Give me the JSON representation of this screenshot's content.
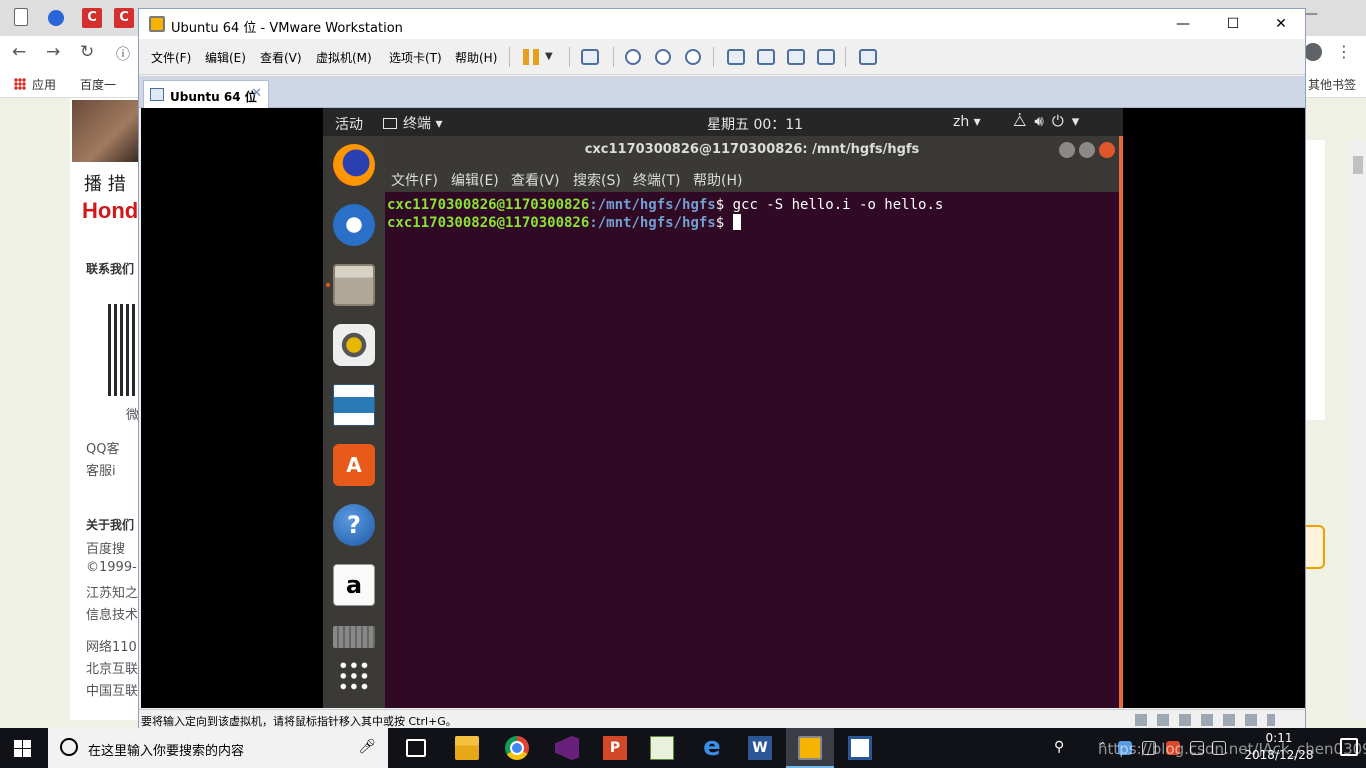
{
  "browser": {
    "bookmarks": {
      "apps": "应用",
      "baidu": "百度一",
      "other": "其他书签"
    },
    "page": {
      "line1": "播 措",
      "brand": "Hond",
      "contact": "联系我们",
      "qr_caption": "微",
      "qq": "QQ客",
      "service": "客服i",
      "about": "关于我们",
      "baidu_line": "百度搜",
      "copyright": "©1999-",
      "jiangsu": "江苏知之",
      "info": "信息技术",
      "net110": "网络110",
      "beijing": "北京互联",
      "china": "中国互联"
    }
  },
  "vmware": {
    "title": "Ubuntu 64 位 - VMware Workstation",
    "menu": [
      "文件(F)",
      "编辑(E)",
      "查看(V)",
      "虚拟机(M)",
      "选项卡(T)",
      "帮助(H)"
    ],
    "tab_label": "Ubuntu 64 位",
    "status_text": "要将输入定向到该虚拟机，请将鼠标指针移入其中或按 Ctrl+G。"
  },
  "ubuntu": {
    "activities": "活动",
    "app_menu": "终端",
    "clock": "星期五 00：11",
    "lang": "zh",
    "terminal": {
      "title": "cxc1170300826@1170300826: /mnt/hgfs/hgfs",
      "menu": [
        "文件(F)",
        "编辑(E)",
        "查看(V)",
        "搜索(S)",
        "终端(T)",
        "帮助(H)"
      ],
      "lines": [
        {
          "user": "cxc1170300826@1170300826",
          "path": ":/mnt/hgfs/hgfs",
          "cmd": "$ gcc -S hello.i -o hello.s"
        },
        {
          "user": "cxc1170300826@1170300826",
          "path": ":/mnt/hgfs/hgfs",
          "cmd": "$ "
        }
      ]
    }
  },
  "taskbar": {
    "search_placeholder": "在这里输入你要搜索的内容",
    "time": "0:11",
    "date": "2018/12/28",
    "watermark": "https://blog.csdn.net/JAck_chen0309"
  }
}
